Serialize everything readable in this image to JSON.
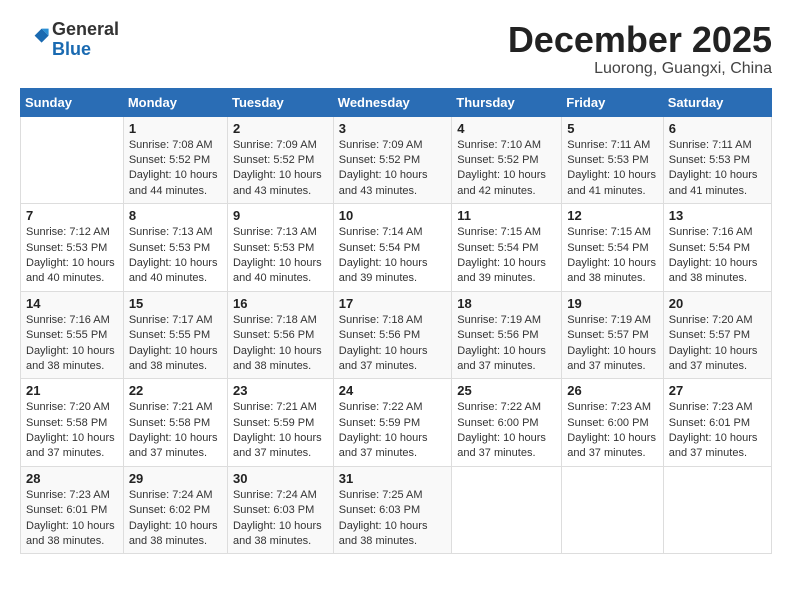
{
  "header": {
    "logo_general": "General",
    "logo_blue": "Blue",
    "month": "December 2025",
    "location": "Luorong, Guangxi, China"
  },
  "days_of_week": [
    "Sunday",
    "Monday",
    "Tuesday",
    "Wednesday",
    "Thursday",
    "Friday",
    "Saturday"
  ],
  "weeks": [
    [
      {
        "day": "",
        "info": ""
      },
      {
        "day": "1",
        "info": "Sunrise: 7:08 AM\nSunset: 5:52 PM\nDaylight: 10 hours and 44 minutes."
      },
      {
        "day": "2",
        "info": "Sunrise: 7:09 AM\nSunset: 5:52 PM\nDaylight: 10 hours and 43 minutes."
      },
      {
        "day": "3",
        "info": "Sunrise: 7:09 AM\nSunset: 5:52 PM\nDaylight: 10 hours and 43 minutes."
      },
      {
        "day": "4",
        "info": "Sunrise: 7:10 AM\nSunset: 5:52 PM\nDaylight: 10 hours and 42 minutes."
      },
      {
        "day": "5",
        "info": "Sunrise: 7:11 AM\nSunset: 5:53 PM\nDaylight: 10 hours and 41 minutes."
      },
      {
        "day": "6",
        "info": "Sunrise: 7:11 AM\nSunset: 5:53 PM\nDaylight: 10 hours and 41 minutes."
      }
    ],
    [
      {
        "day": "7",
        "info": "Sunrise: 7:12 AM\nSunset: 5:53 PM\nDaylight: 10 hours and 40 minutes."
      },
      {
        "day": "8",
        "info": "Sunrise: 7:13 AM\nSunset: 5:53 PM\nDaylight: 10 hours and 40 minutes."
      },
      {
        "day": "9",
        "info": "Sunrise: 7:13 AM\nSunset: 5:53 PM\nDaylight: 10 hours and 40 minutes."
      },
      {
        "day": "10",
        "info": "Sunrise: 7:14 AM\nSunset: 5:54 PM\nDaylight: 10 hours and 39 minutes."
      },
      {
        "day": "11",
        "info": "Sunrise: 7:15 AM\nSunset: 5:54 PM\nDaylight: 10 hours and 39 minutes."
      },
      {
        "day": "12",
        "info": "Sunrise: 7:15 AM\nSunset: 5:54 PM\nDaylight: 10 hours and 38 minutes."
      },
      {
        "day": "13",
        "info": "Sunrise: 7:16 AM\nSunset: 5:54 PM\nDaylight: 10 hours and 38 minutes."
      }
    ],
    [
      {
        "day": "14",
        "info": "Sunrise: 7:16 AM\nSunset: 5:55 PM\nDaylight: 10 hours and 38 minutes."
      },
      {
        "day": "15",
        "info": "Sunrise: 7:17 AM\nSunset: 5:55 PM\nDaylight: 10 hours and 38 minutes."
      },
      {
        "day": "16",
        "info": "Sunrise: 7:18 AM\nSunset: 5:56 PM\nDaylight: 10 hours and 38 minutes."
      },
      {
        "day": "17",
        "info": "Sunrise: 7:18 AM\nSunset: 5:56 PM\nDaylight: 10 hours and 37 minutes."
      },
      {
        "day": "18",
        "info": "Sunrise: 7:19 AM\nSunset: 5:56 PM\nDaylight: 10 hours and 37 minutes."
      },
      {
        "day": "19",
        "info": "Sunrise: 7:19 AM\nSunset: 5:57 PM\nDaylight: 10 hours and 37 minutes."
      },
      {
        "day": "20",
        "info": "Sunrise: 7:20 AM\nSunset: 5:57 PM\nDaylight: 10 hours and 37 minutes."
      }
    ],
    [
      {
        "day": "21",
        "info": "Sunrise: 7:20 AM\nSunset: 5:58 PM\nDaylight: 10 hours and 37 minutes."
      },
      {
        "day": "22",
        "info": "Sunrise: 7:21 AM\nSunset: 5:58 PM\nDaylight: 10 hours and 37 minutes."
      },
      {
        "day": "23",
        "info": "Sunrise: 7:21 AM\nSunset: 5:59 PM\nDaylight: 10 hours and 37 minutes."
      },
      {
        "day": "24",
        "info": "Sunrise: 7:22 AM\nSunset: 5:59 PM\nDaylight: 10 hours and 37 minutes."
      },
      {
        "day": "25",
        "info": "Sunrise: 7:22 AM\nSunset: 6:00 PM\nDaylight: 10 hours and 37 minutes."
      },
      {
        "day": "26",
        "info": "Sunrise: 7:23 AM\nSunset: 6:00 PM\nDaylight: 10 hours and 37 minutes."
      },
      {
        "day": "27",
        "info": "Sunrise: 7:23 AM\nSunset: 6:01 PM\nDaylight: 10 hours and 37 minutes."
      }
    ],
    [
      {
        "day": "28",
        "info": "Sunrise: 7:23 AM\nSunset: 6:01 PM\nDaylight: 10 hours and 38 minutes."
      },
      {
        "day": "29",
        "info": "Sunrise: 7:24 AM\nSunset: 6:02 PM\nDaylight: 10 hours and 38 minutes."
      },
      {
        "day": "30",
        "info": "Sunrise: 7:24 AM\nSunset: 6:03 PM\nDaylight: 10 hours and 38 minutes."
      },
      {
        "day": "31",
        "info": "Sunrise: 7:25 AM\nSunset: 6:03 PM\nDaylight: 10 hours and 38 minutes."
      },
      {
        "day": "",
        "info": ""
      },
      {
        "day": "",
        "info": ""
      },
      {
        "day": "",
        "info": ""
      }
    ]
  ]
}
